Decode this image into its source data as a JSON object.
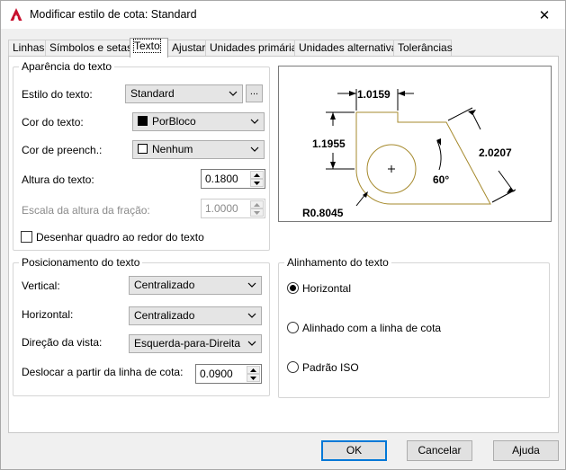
{
  "window": {
    "title": "Modificar estilo de cota: Standard",
    "close_glyph": "✕"
  },
  "tabs": [
    {
      "label": "Linhas",
      "active": false
    },
    {
      "label": "Símbolos e setas",
      "active": false
    },
    {
      "label": "Texto",
      "active": true
    },
    {
      "label": "Ajustar",
      "active": false
    },
    {
      "label": "Unidades primárias",
      "active": false
    },
    {
      "label": "Unidades alternativas",
      "active": false
    },
    {
      "label": "Tolerâncias",
      "active": false
    }
  ],
  "appearance": {
    "group_title": "Aparência do texto",
    "style_label": "Estilo do texto:",
    "style_value": "Standard",
    "style_browse": "...",
    "color_label": "Cor do texto:",
    "color_value": "PorBloco",
    "fill_label": "Cor de preench.:",
    "fill_value": "Nenhum",
    "height_label": "Altura do texto:",
    "height_value": "0.1800",
    "fraction_label": "Escala da altura da fração:",
    "fraction_value": "1.0000",
    "frame_label": "Desenhar quadro ao redor do texto",
    "frame_checked": false
  },
  "placement": {
    "group_title": "Posicionamento do texto",
    "vertical_label": "Vertical:",
    "vertical_value": "Centralizado",
    "horizontal_label": "Horizontal:",
    "horizontal_value": "Centralizado",
    "direction_label": "Direção da vista:",
    "direction_value": "Esquerda-para-Direita",
    "offset_label": "Deslocar a partir da linha de cota:",
    "offset_value": "0.0900"
  },
  "alignment": {
    "group_title": "Alinhamento do texto",
    "options": [
      {
        "label": "Horizontal",
        "selected": true
      },
      {
        "label": "Alinhado com a linha de cota",
        "selected": false
      },
      {
        "label": "Padrão ISO",
        "selected": false
      }
    ]
  },
  "preview": {
    "dim_top": "1.0159",
    "dim_left": "1.1955",
    "dim_right": "2.0207",
    "angle": "60°",
    "radius": "R0.8045",
    "geometry_color": "#a68a2d"
  },
  "buttons": {
    "ok": "OK",
    "cancel": "Cancelar",
    "help": "Ajuda"
  },
  "colors": {
    "accent": "#0078d7",
    "autocad_red": "#c8102e"
  },
  "icons": {
    "app": "autocad-a-icon",
    "close": "close-icon",
    "dropdown": "chevron-down-icon"
  }
}
